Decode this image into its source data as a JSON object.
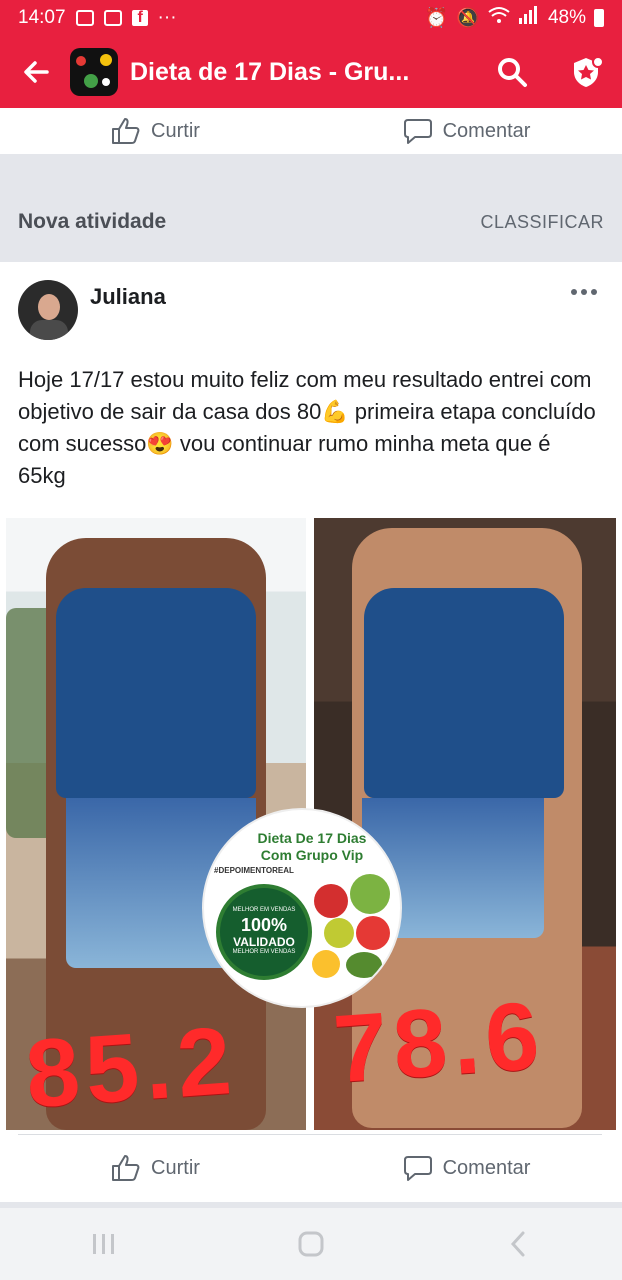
{
  "statusbar": {
    "time": "14:07",
    "battery": "48%"
  },
  "appbar": {
    "title": "Dieta de 17 Dias - Gru..."
  },
  "prev_post": {
    "like_label": "Curtir",
    "comment_label": "Comentar"
  },
  "section": {
    "title": "Nova atividade",
    "action": "CLASSIFICAR"
  },
  "post": {
    "author": "Juliana",
    "text": "Hoje 17/17 estou muito feliz com meu resultado entrei com objetivo de sair da casa dos 80💪 primeira etapa  concluído com sucesso😍 vou continuar rumo minha meta que é 65kg",
    "photos": {
      "left_weight": "85.2",
      "right_weight": "78.6",
      "seal": {
        "title": "Dieta De 17 Dias Com Grupo Vip",
        "tag": "#DEPOIMENTOREAL",
        "arc_top": "MELHOR EM VENDAS",
        "percent": "100%",
        "validated": "VALIDADO",
        "arc_bottom": "MELHOR EM VENDAS"
      }
    },
    "like_label": "Curtir",
    "comment_label": "Comentar"
  },
  "icons": {
    "back": "arrow-left-icon",
    "search": "search-icon",
    "badge": "star-shield-icon",
    "more": "more-horizontal-icon",
    "like": "thumbs-up-icon",
    "comment": "comment-icon"
  },
  "colors": {
    "brand": "#e8203f",
    "text": "#1c1e21",
    "muted": "#606770"
  }
}
